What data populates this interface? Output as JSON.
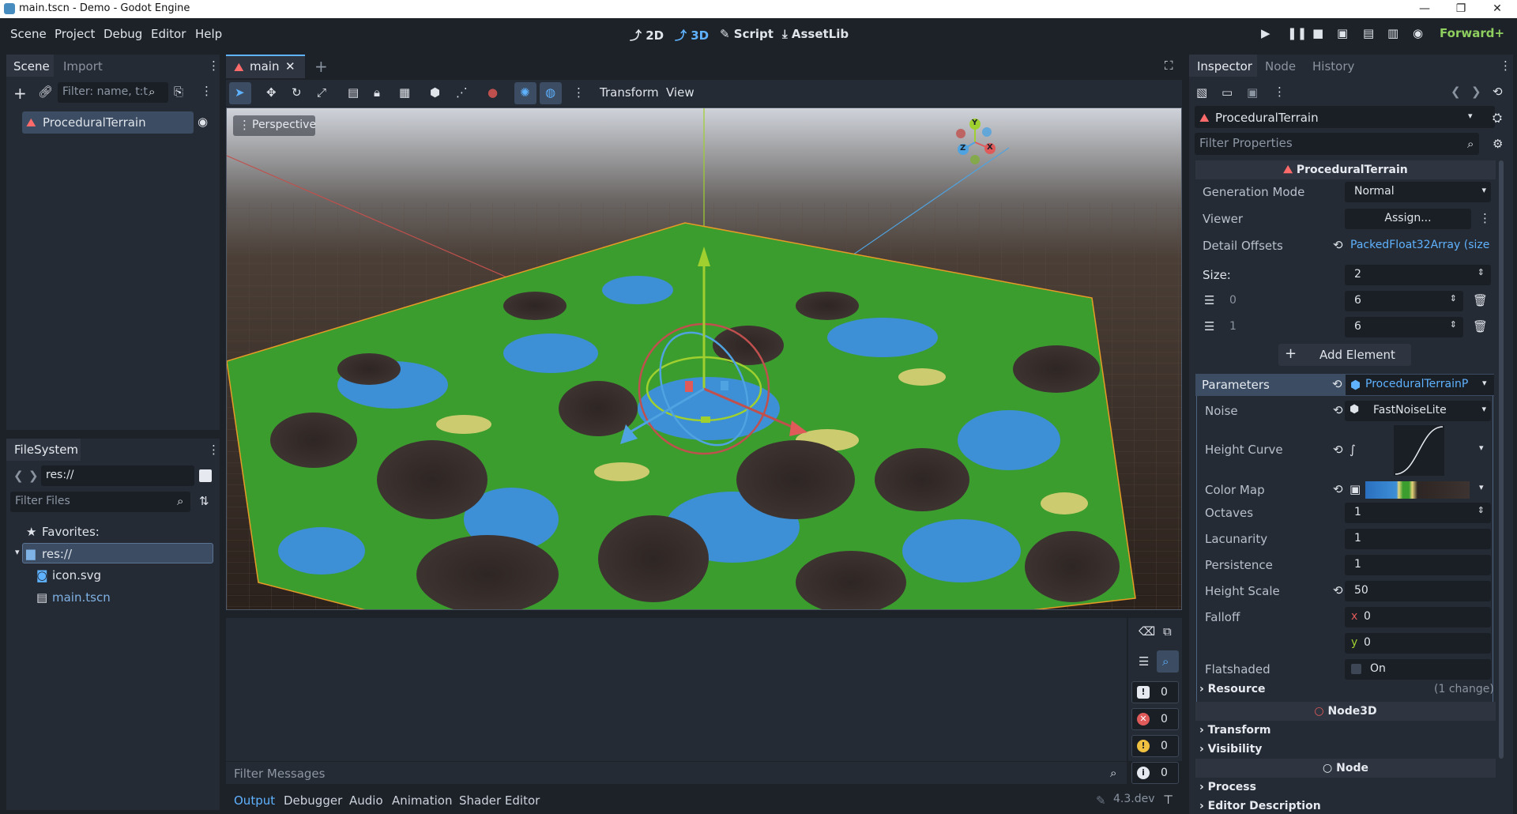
{
  "window": {
    "title": "main.tscn - Demo - Godot Engine"
  },
  "menu": [
    "Scene",
    "Project",
    "Debug",
    "Editor",
    "Help"
  ],
  "modes": [
    {
      "label": "2D",
      "icon": "2d-icon"
    },
    {
      "label": "3D",
      "icon": "3d-icon"
    },
    {
      "label": "Script",
      "icon": "script-icon"
    },
    {
      "label": "AssetLib",
      "icon": "assetlib-icon"
    }
  ],
  "renderer": "Forward+",
  "scene_dock": {
    "tabs": [
      "Scene",
      "Import"
    ],
    "filter_placeholder": "Filter: name, t:t",
    "root_node": "ProceduralTerrain"
  },
  "filesystem": {
    "tab": "FileSystem",
    "path": "res://",
    "filter_placeholder": "Filter Files",
    "favorites": "Favorites:",
    "items": [
      "res://",
      "icon.svg",
      "main.tscn"
    ]
  },
  "editor_tabs": {
    "active": "main"
  },
  "viewport_toolbar": {
    "transform": "Transform",
    "view": "View",
    "perspective": "Perspective"
  },
  "gizmo_axes": {
    "x": "X",
    "y": "Y",
    "z": "Z"
  },
  "inspector": {
    "tabs": [
      "Inspector",
      "Node",
      "History"
    ],
    "object": "ProceduralTerrain",
    "filter_placeholder": "Filter Properties",
    "class_header": "ProceduralTerrain",
    "generation_mode": {
      "label": "Generation Mode",
      "value": "Normal"
    },
    "viewer": {
      "label": "Viewer",
      "value": "Assign..."
    },
    "detail_offsets": {
      "label": "Detail Offsets",
      "value": "PackedFloat32Array (size 2"
    },
    "size": {
      "label": "Size:",
      "value": "2"
    },
    "array_items": [
      {
        "index": "0",
        "value": "6"
      },
      {
        "index": "1",
        "value": "6"
      }
    ],
    "add_element": "Add Element",
    "parameters": {
      "label": "Parameters",
      "value": "ProceduralTerrainP"
    },
    "noise": {
      "label": "Noise",
      "value": "FastNoiseLite"
    },
    "height_curve": {
      "label": "Height Curve"
    },
    "color_map": {
      "label": "Color Map"
    },
    "octaves": {
      "label": "Octaves",
      "value": "1"
    },
    "lacunarity": {
      "label": "Lacunarity",
      "value": "1"
    },
    "persistence": {
      "label": "Persistence",
      "value": "1"
    },
    "height_scale": {
      "label": "Height Scale",
      "value": "50"
    },
    "falloff": {
      "label": "Falloff",
      "x_label": "x",
      "x": "0",
      "y_label": "y",
      "y": "0"
    },
    "flatshaded": {
      "label": "Flatshaded",
      "value": "On"
    },
    "resource": {
      "label": "Resource",
      "note": "(1 change)"
    },
    "node3d": "Node3D",
    "transform": "Transform",
    "visibility": "Visibility",
    "node": "Node",
    "process": "Process",
    "editor_description": "Editor Description"
  },
  "output": {
    "filter_placeholder": "Filter Messages",
    "counts": {
      "messages": "0",
      "errors": "0",
      "warnings": "0",
      "info": "0"
    },
    "tabs": [
      "Output",
      "Debugger",
      "Audio",
      "Animation",
      "Shader Editor"
    ],
    "version": "4.3.dev"
  },
  "colors": {
    "accent": "#5fb2ff",
    "panel": "#252b34",
    "bg": "#1d2229"
  }
}
